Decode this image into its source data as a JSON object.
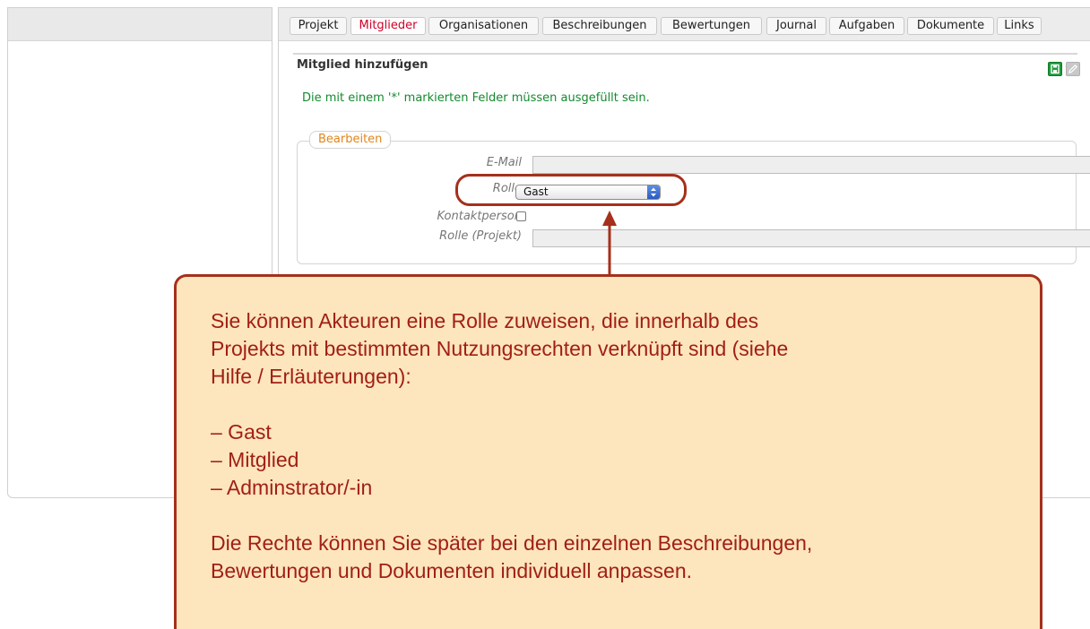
{
  "tabs": [
    {
      "label": "Projekt"
    },
    {
      "label": "Mitglieder"
    },
    {
      "label": "Organisationen"
    },
    {
      "label": "Beschreibungen"
    },
    {
      "label": "Bewertungen"
    },
    {
      "label": "Journal"
    },
    {
      "label": "Aufgaben"
    },
    {
      "label": "Dokumente"
    },
    {
      "label": "Links"
    }
  ],
  "active_tab": "Mitglieder",
  "section": {
    "title": "Mitglied hinzufügen",
    "required_note": "Die mit einem '*' markierten Felder müssen ausgefüllt sein.",
    "legend": "Bearbeiten"
  },
  "form": {
    "email_label": "E-Mail",
    "email_value": "",
    "role_label": "Rolle",
    "role_value": "Gast",
    "contact_label": "Kontaktperson",
    "contact_checked": false,
    "project_role_label": "Rolle (Projekt)",
    "project_role_value": ""
  },
  "icons": {
    "save": "save-icon",
    "edit": "pencil-icon"
  },
  "colors": {
    "active_tab": "#d0002a",
    "required_note": "#138a2e",
    "legend": "#e0861a",
    "callout_border": "#a5301c",
    "callout_bg": "#fde5bd",
    "callout_text": "#a11f15"
  },
  "callout": {
    "intro_1": "Sie können Akteuren eine Rolle zuweisen, die innerhalb des",
    "intro_2": "Projekts mit bestimmten Nutzungsrechten verknüpft sind (siehe",
    "intro_3": "Hilfe / Erläuterungen):",
    "roles": [
      "– Gast",
      "– Mitglied",
      "– Adminstrator/-in"
    ],
    "footer_1": "Die Rechte können Sie später bei den einzelnen Beschreibungen,",
    "footer_2": "Bewertungen und Dokumenten individuell anpassen."
  }
}
